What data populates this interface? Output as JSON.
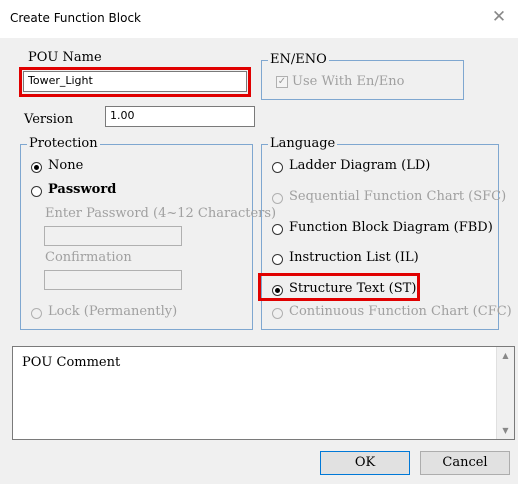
{
  "window": {
    "title": "Create Function Block",
    "close_glyph": "✕"
  },
  "pou": {
    "name_label": "POU Name",
    "name_value": "Tower_Light",
    "version_label": "Version",
    "version_value": "1.00"
  },
  "en_eno": {
    "label": "EN/ENO",
    "use_label": "Use With En/Eno",
    "checked": true
  },
  "protection": {
    "label": "Protection",
    "none_label": "None",
    "password_label": "Password",
    "enter_password_label": "Enter Password (4~12 Characters)",
    "confirmation_label": "Confirmation",
    "lock_label": "Lock (Permanently)",
    "selected": "None"
  },
  "language": {
    "label": "Language",
    "options": [
      {
        "label": "Ladder Diagram (LD)",
        "enabled": true
      },
      {
        "label": "Sequential Function Chart (SFC)",
        "enabled": false
      },
      {
        "label": "Function Block Diagram (FBD)",
        "enabled": true
      },
      {
        "label": "Instruction List (IL)",
        "enabled": true
      },
      {
        "label": "Structure Text (ST)",
        "enabled": true,
        "selected": true
      },
      {
        "label": "Continuous Function Chart (CFC)",
        "enabled": false
      }
    ]
  },
  "comment": {
    "label": "POU Comment"
  },
  "buttons": {
    "ok": "OK",
    "cancel": "Cancel"
  },
  "colors": {
    "highlight": "#e00000",
    "group_border": "#7fa7d0",
    "dialog_bg": "#f0f0f0"
  }
}
